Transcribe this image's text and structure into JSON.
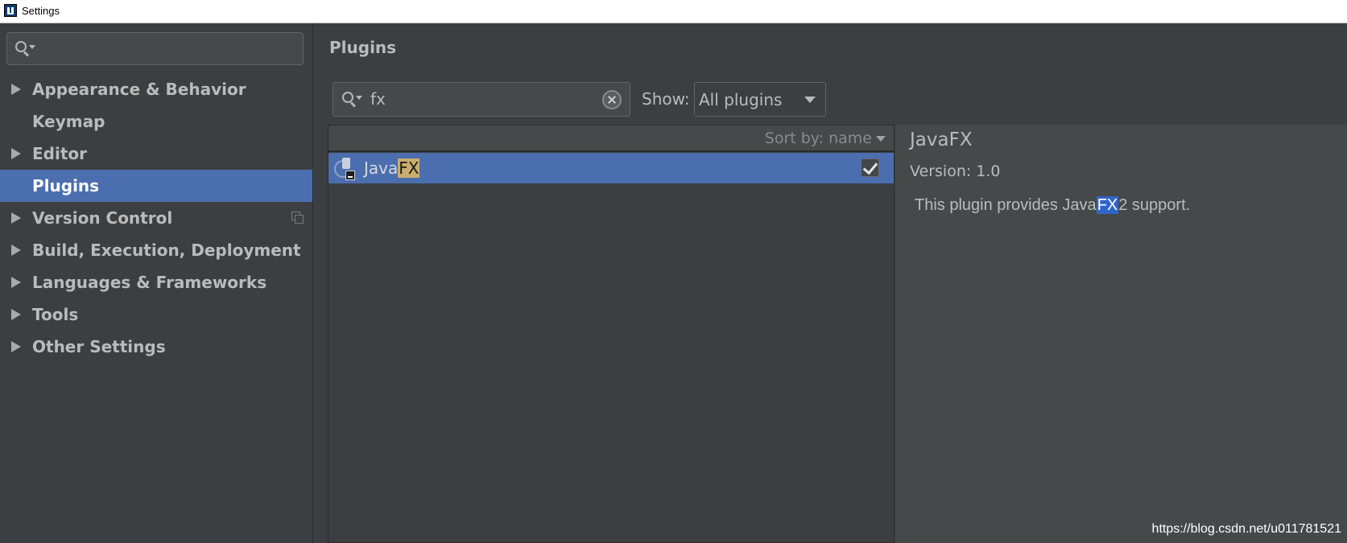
{
  "window": {
    "title": "Settings"
  },
  "sidebar": {
    "search_value": "",
    "items": [
      {
        "label": "Appearance & Behavior",
        "expandable": true,
        "selected": false
      },
      {
        "label": "Keymap",
        "expandable": false,
        "selected": false
      },
      {
        "label": "Editor",
        "expandable": true,
        "selected": false
      },
      {
        "label": "Plugins",
        "expandable": false,
        "selected": true
      },
      {
        "label": "Version Control",
        "expandable": true,
        "selected": false,
        "trailing_icon": "copy-icon"
      },
      {
        "label": "Build, Execution, Deployment",
        "expandable": true,
        "selected": false
      },
      {
        "label": "Languages & Frameworks",
        "expandable": true,
        "selected": false
      },
      {
        "label": "Tools",
        "expandable": true,
        "selected": false
      },
      {
        "label": "Other Settings",
        "expandable": true,
        "selected": false
      }
    ]
  },
  "main": {
    "title": "Plugins",
    "filter": {
      "value": "fx"
    },
    "show": {
      "label": "Show:",
      "selected": "All plugins"
    },
    "list": {
      "sort_label": "Sort by: name",
      "rows": [
        {
          "name_prefix": "Java",
          "name_highlight": "FX",
          "checked": true,
          "selected": true
        }
      ]
    },
    "details": {
      "name": "JavaFX",
      "version": "Version: 1.0",
      "description_before": "This plugin provides Java",
      "description_highlight": "FX",
      "description_after": "2 support."
    }
  },
  "watermark": "https://blog.csdn.net/u011781521",
  "colors": {
    "background": "#3c3f41",
    "selection": "#4b6eaf",
    "match_highlight": "#c9ad6d",
    "text_highlight": "#2f65ca",
    "text": "#bbbbbb"
  }
}
